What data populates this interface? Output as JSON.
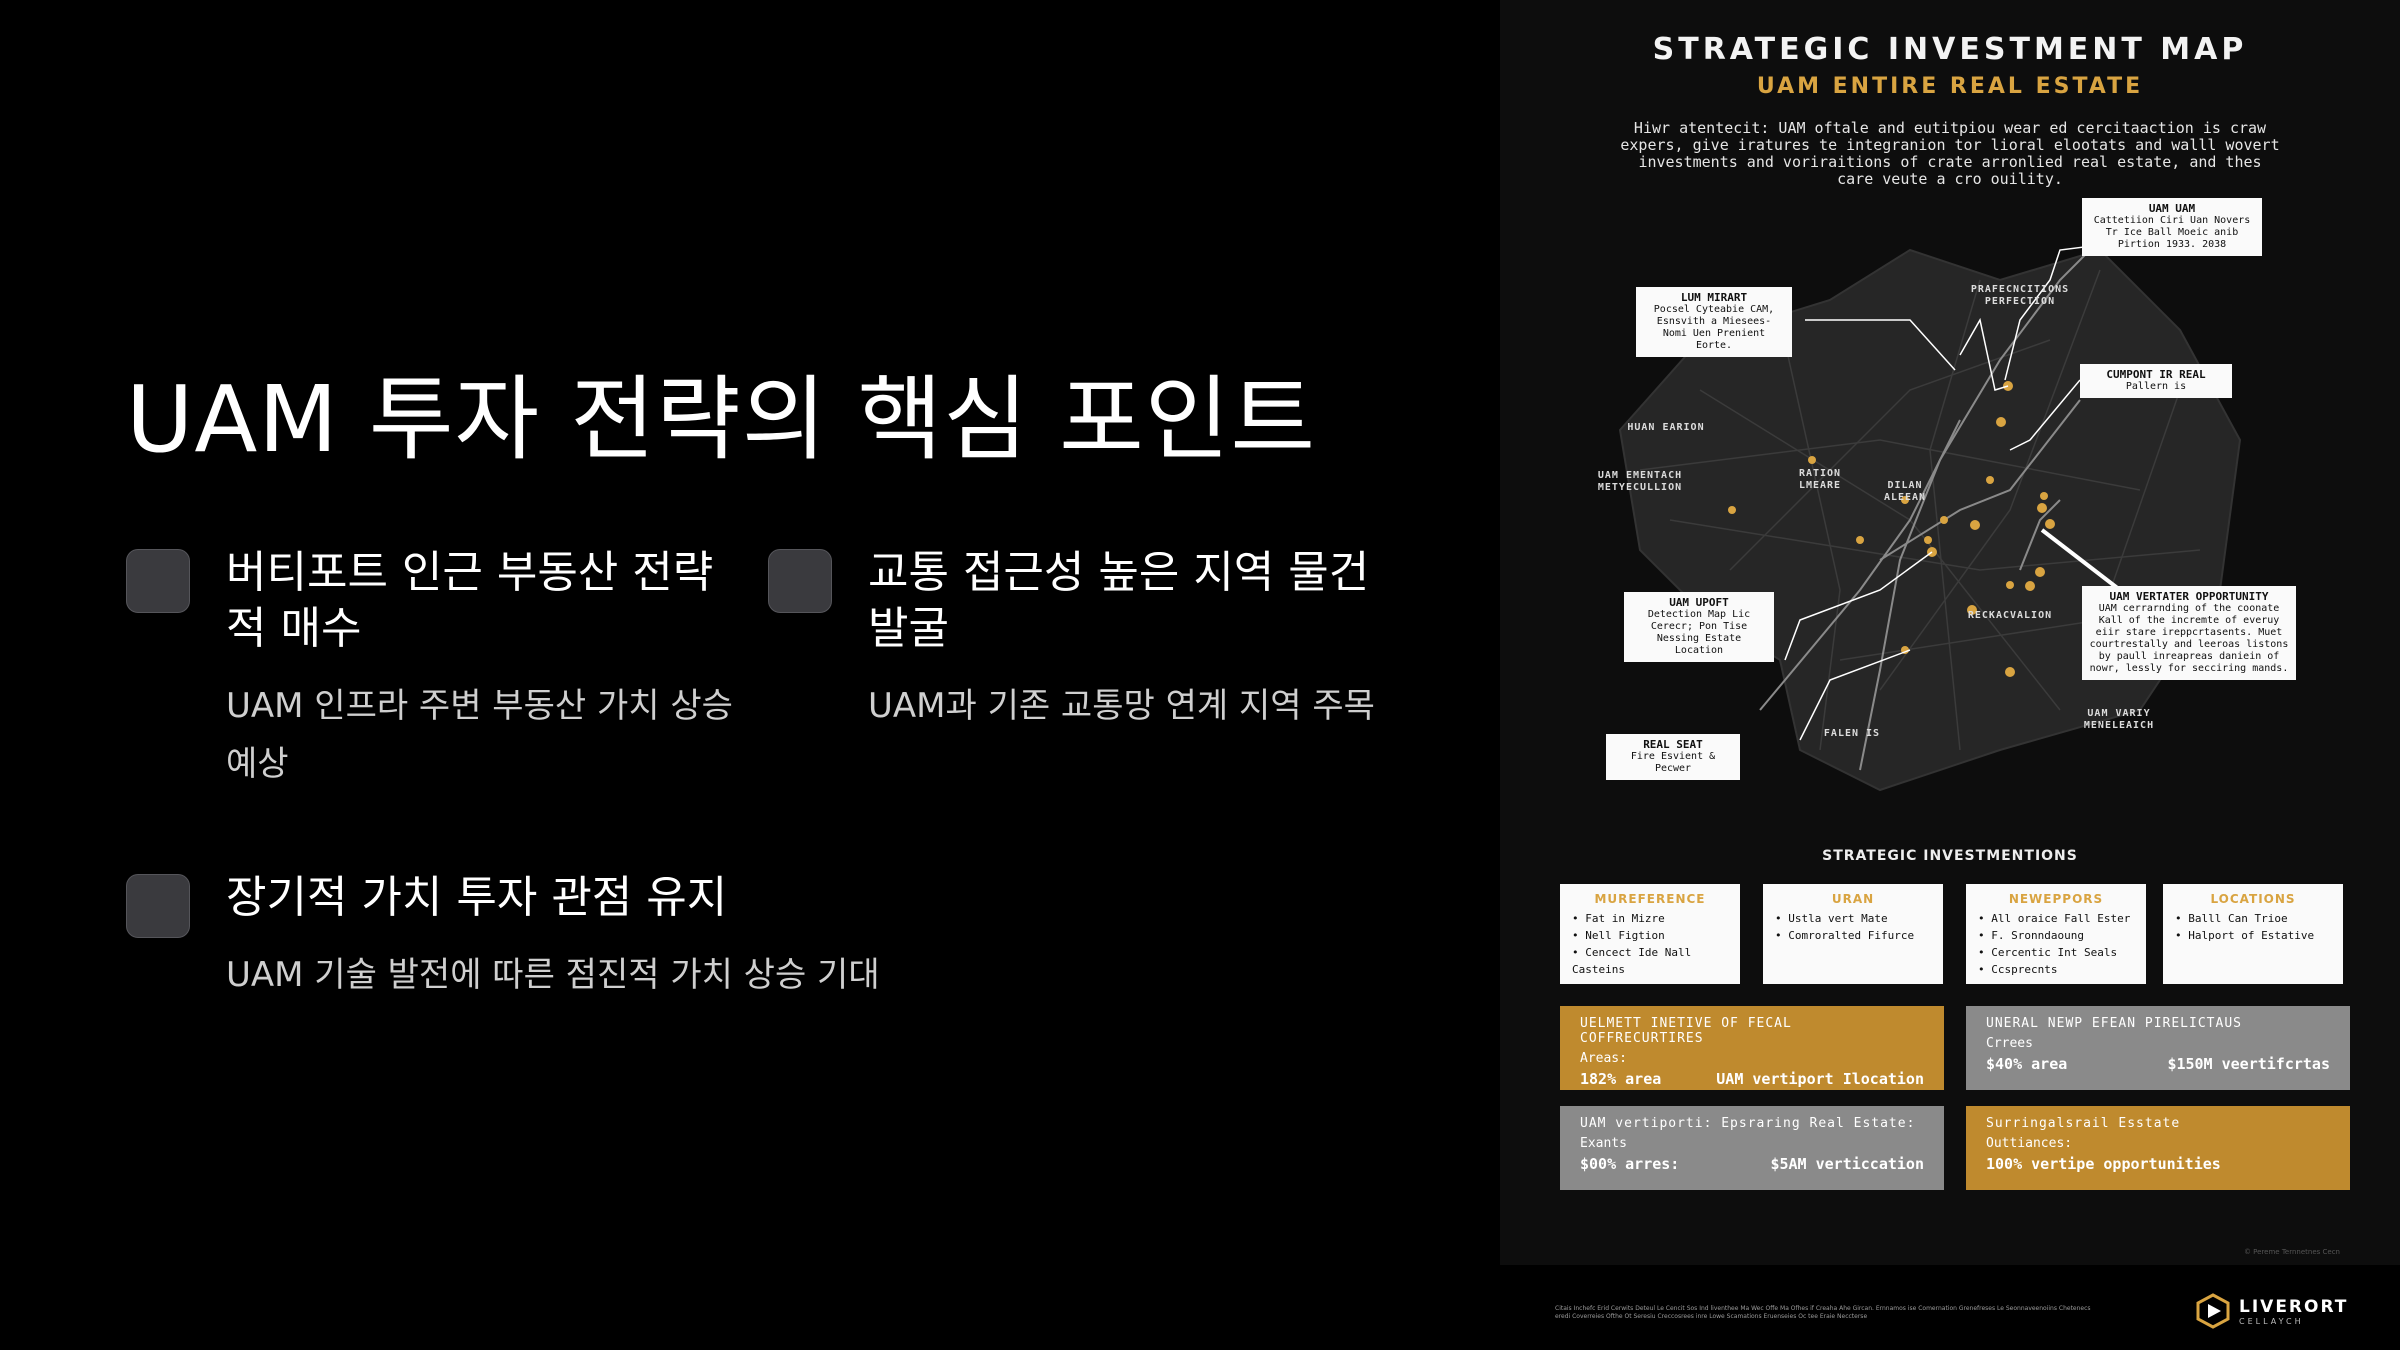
{
  "slide": {
    "title": "UAM 투자 전략의 핵심 포인트",
    "points": [
      {
        "title": "버티포트 인근 부동산 전략적 매수",
        "desc": "UAM 인프라 주변 부동산 가치 상승 예상"
      },
      {
        "title": "교통 접근성 높은 지역 물건 발굴",
        "desc": "UAM과 기존 교통망 연계 지역 주목"
      },
      {
        "title": "장기적 가치 투자 관점 유지",
        "desc": "UAM 기술 발전에 따른 점진적 가치 상승 기대"
      }
    ]
  },
  "poster": {
    "title": "STRATEGIC INVESTMENT MAP",
    "subtitle": "UAM ENTIRE REAL ESTATE",
    "intro": "Hiwr atentecit: UAM oftale and eutitpiou wear ed cercitaaction is craw expers, give iratures te integranion tor lioral elootats and walll wovert investments and voriraitions of crate arronlied real estate, and thes care veute a cro ouility.",
    "callouts": {
      "uam_uam": {
        "head": "UAM UAM",
        "body": "Cattetiion Ciri Uan Novers Tr Ice Ball Moeic anib Pirtion 1933. 2038"
      },
      "lum_mirart": {
        "head": "LUM MIRART",
        "body": "Pocsel Cyteabie CAM, Esnsvith a Miesees- Nomi Uen Prenient Eorte."
      },
      "cumpont": {
        "head": "CUMPONT IR REAL",
        "body": "Pallern is"
      },
      "uam_upoft": {
        "head": "UAM UPOFT",
        "body": "Detection Map Lic Cerecr; Pon Tise Nessing Estate Location"
      },
      "real_seat": {
        "head": "REAL SEAT",
        "body": "Fire Esvient & Pecwer"
      },
      "vertater": {
        "head": "UAM VERTATER OPPORTUNITY",
        "body": "UAM cerrarnding of the coonate Kall of the incremte of everuy eiir stare ireppcrtasents. Muet courtrestally and leeroas listons by paull inreapreas daniein of nowr, lessly for secciring mands."
      }
    },
    "map_labels": {
      "prefecutions": "PRAFECNCITIONS PERFECTION",
      "huan_earion": "HUAN EARION",
      "uam_ementach": "UAM EMENTACH METYECULLION",
      "ration_lmeare": "RATION LMEARE",
      "dilan_aleean": "DILAN ALEEAN",
      "reckacvalion": "RECKACVALION",
      "falen_is": "FALEN IS",
      "uam_vary": "UAM VARIY MENELEAICH"
    },
    "section_heading": "STRATEGIC INVESTMENTIONS",
    "cards": [
      {
        "title": "MUREFERENCE",
        "items": [
          "Fat in Mizre",
          "Nell Figtion",
          "Cencect Ide Nall Casteins"
        ]
      },
      {
        "title": "URAN",
        "items": [
          "Ustla vert Mate",
          "Comroralted Fifurce"
        ]
      },
      {
        "title": "NEWEPPORS",
        "items": [
          "All oraice Fall Ester",
          "F. Sronndaoung",
          "Cercentic Int Seals",
          "Ccsprecnts"
        ]
      },
      {
        "title": "LOCATIONS",
        "items": [
          "Balll Can Trioe",
          "Halport of Estative"
        ]
      }
    ],
    "stats": [
      {
        "line1": "UELMETT INETIVE OF FECAL COFFRECURTIRES",
        "line2": "Areas:",
        "a": "182% area",
        "b": "UAM vertiport Ilocation"
      },
      {
        "line1": "UNERAL NEWP EFEAN PIRELICTAUS",
        "line2": "Crrees",
        "a": "$40% area",
        "b": "$150M veertifcrtas"
      },
      {
        "line1": "UAM vertiporti: Epsraring Real Estate:",
        "line2": "Exants",
        "a": "$00% arres:",
        "b": "$5AM verticcation"
      },
      {
        "line1": "Surringalsrail Esstate",
        "line2": "Outtiances:",
        "a": "100% vertipe opportunities",
        "b": ""
      }
    ],
    "fine_print_small": "© Pereme Ternnetnes Cecn",
    "footer_fine_print": "Citais Inchefc Erid Cerwits Deteul Le Cencit Sos Ind liventhee Ma Wec Offe Ma Ofhes if Creaha Ahe Gircan. Ernnamos ise Comernation Grenefreses Le Seonnaveenoiins Chetenecs eredi Coverreies Ofthe Ot Seresiu Creccosrees inre Lowe Scamations Eruenseies Oc tee Eraie Neccterse",
    "logo": {
      "name": "LIVERORT",
      "tagline": "CELLAYCH"
    }
  },
  "colors": {
    "accent_gold": "#d9a441",
    "stat_gold": "#bf8a2e",
    "stat_grey": "#8a8a8a",
    "bullet_box": "#3a3a3e"
  }
}
